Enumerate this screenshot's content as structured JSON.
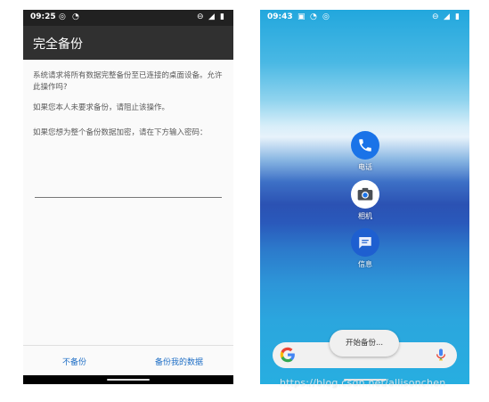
{
  "left_screen": {
    "status_time": "09:25",
    "title": "完全备份",
    "paragraph1": "系统请求将所有数据完整备份至已连接的桌面设备。允许此操作吗?",
    "paragraph2": "如果您本人未要求备份，请阻止该操作。",
    "paragraph3": "如果您想为整个备份数据加密，请在下方输入密码：",
    "password_value": "",
    "buttons": {
      "no_backup": "不备份",
      "backup_my_data": "备份我的数据"
    }
  },
  "right_screen": {
    "status_time": "09:43",
    "apps": [
      {
        "label": "电话",
        "icon": "phone-icon"
      },
      {
        "label": "相机",
        "icon": "camera-icon"
      },
      {
        "label": "信息",
        "icon": "messages-icon"
      }
    ],
    "toast": "开始备份...",
    "search_icons": [
      "google-logo-icon",
      "mic-icon"
    ]
  },
  "watermark": "https://blog.csdn.net/allisonchen",
  "colors": {
    "dialog_button": "#1f6fc6",
    "phone_app": "#1a73e8",
    "messages_app": "#1e5fd0",
    "appbar": "#303030"
  }
}
